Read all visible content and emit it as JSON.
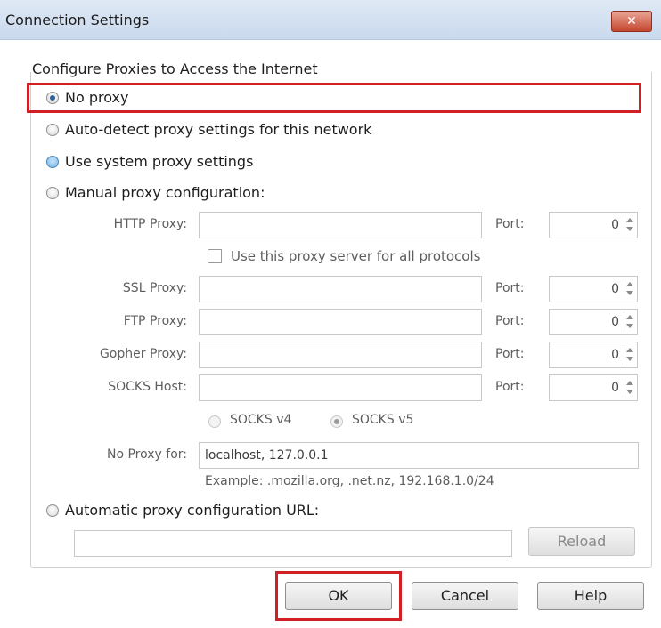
{
  "window": {
    "title": "Connection Settings"
  },
  "group": {
    "title": "Configure Proxies to Access the Internet"
  },
  "options": {
    "no_proxy": "No proxy",
    "auto_detect": "Auto-detect proxy settings for this network",
    "system": "Use system proxy settings",
    "manual": "Manual proxy configuration:",
    "auto_url": "Automatic proxy configuration URL:"
  },
  "manual": {
    "http_label": "HTTP Proxy:",
    "http_value": "",
    "http_port_label": "Port:",
    "http_port": "0",
    "use_for_all_label": "Use this proxy server for all protocols",
    "ssl_label": "SSL Proxy:",
    "ssl_value": "",
    "ssl_port_label": "Port:",
    "ssl_port": "0",
    "ftp_label": "FTP Proxy:",
    "ftp_value": "",
    "ftp_port_label": "Port:",
    "ftp_port": "0",
    "gopher_label": "Gopher Proxy:",
    "gopher_value": "",
    "gopher_port_label": "Port:",
    "gopher_port": "0",
    "socks_label": "SOCKS Host:",
    "socks_value": "",
    "socks_port_label": "Port:",
    "socks_port": "0",
    "socks_v4": "SOCKS v4",
    "socks_v5": "SOCKS v5",
    "no_proxy_for_label": "No Proxy for:",
    "no_proxy_for_value": "localhost, 127.0.0.1",
    "example": "Example: .mozilla.org, .net.nz, 192.168.1.0/24"
  },
  "auto_url": {
    "value": "",
    "reload": "Reload"
  },
  "buttons": {
    "ok": "OK",
    "cancel": "Cancel",
    "help": "Help"
  },
  "colors": {
    "highlight": "#d11f26",
    "accent": "#2d5d9a"
  }
}
